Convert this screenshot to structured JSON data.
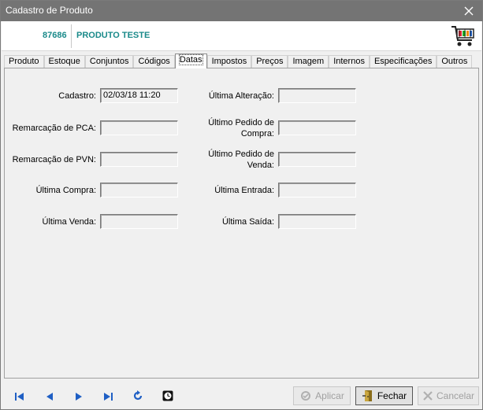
{
  "window": {
    "title": "Cadastro de Produto"
  },
  "header": {
    "code": "87686",
    "product_name": "PRODUTO TESTE"
  },
  "tabs": [
    {
      "label": "Produto"
    },
    {
      "label": "Estoque"
    },
    {
      "label": "Conjuntos"
    },
    {
      "label": "Códigos"
    },
    {
      "label": "Datas"
    },
    {
      "label": "Impostos"
    },
    {
      "label": "Preços"
    },
    {
      "label": "Imagem"
    },
    {
      "label": "Internos"
    },
    {
      "label": "Especificações"
    },
    {
      "label": "Outros"
    }
  ],
  "active_tab": "Datas",
  "fields": {
    "cadastro": {
      "label": "Cadastro:",
      "value": "02/03/18 11:20"
    },
    "remarcacao_pca": {
      "label": "Remarcação de PCA:",
      "value": ""
    },
    "remarcacao_pvn": {
      "label": "Remarcação de PVN:",
      "value": ""
    },
    "ultima_compra": {
      "label": "Última Compra:",
      "value": ""
    },
    "ultima_venda": {
      "label": "Última Venda:",
      "value": ""
    },
    "ultima_alteracao": {
      "label": "Última Alteração:",
      "value": ""
    },
    "ultimo_pedido_compra": {
      "label_line1": "Último Pedido de",
      "label_line2": "Compra:",
      "value": ""
    },
    "ultimo_pedido_venda": {
      "label_line1": "Último Pedido de",
      "label_line2": "Venda:",
      "value": ""
    },
    "ultima_entrada": {
      "label": "Última Entrada:",
      "value": ""
    },
    "ultima_saida": {
      "label": "Última Saída:",
      "value": ""
    }
  },
  "buttons": {
    "apply": "Aplicar",
    "close": "Fechar",
    "cancel": "Cancelar"
  },
  "colors": {
    "accent": "#1a8a8a",
    "titlebar": "#747474",
    "nav": "#1f5fc4"
  }
}
